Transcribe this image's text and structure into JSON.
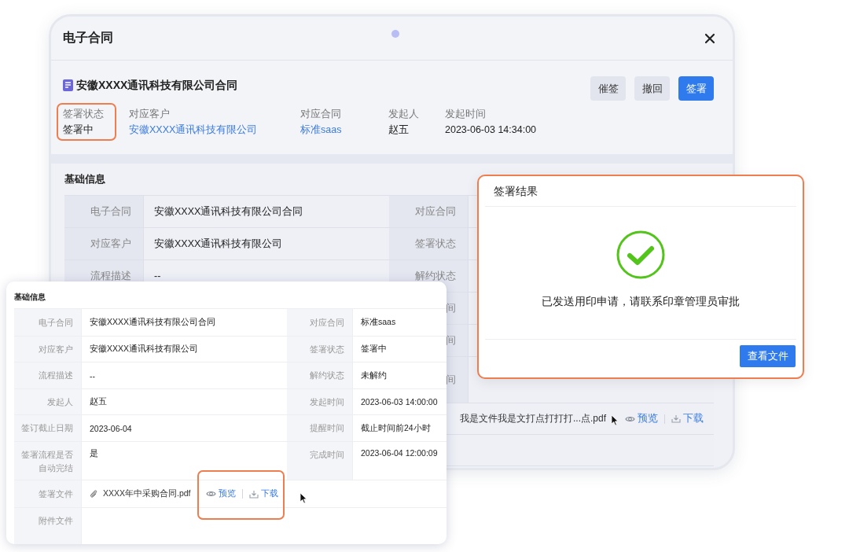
{
  "tablet_window": {
    "title": "电子合同",
    "contract": {
      "title": "安徽XXXX通讯科技有限公司合同",
      "buttons": [
        {
          "label": "催签",
          "kind": "secondary"
        },
        {
          "label": "撤回",
          "kind": "secondary"
        },
        {
          "label": "签署",
          "kind": "primary"
        }
      ],
      "fields": [
        {
          "label": "签署状态",
          "value": "签署中",
          "kind": "text",
          "highlighted": true
        },
        {
          "label": "对应客户",
          "value": "安徽XXXX通讯科技有限公司",
          "kind": "link"
        },
        {
          "label": "对应合同",
          "value": "标准saas",
          "kind": "link"
        },
        {
          "label": "发起人",
          "value": "赵五",
          "kind": "text"
        },
        {
          "label": "发起时间",
          "value": "2023-06-03 14:34:00",
          "kind": "text"
        }
      ]
    },
    "section_title": "基础信息",
    "rows": [
      {
        "left_label": "电子合同",
        "left_value": "安徽XXXX通讯科技有限公司合同",
        "right_label": "对应合同"
      },
      {
        "left_label": "对应客户",
        "left_value": "安徽XXXX通讯科技有限公司",
        "right_label": "签署状态"
      },
      {
        "left_label": "流程描述",
        "left_value": "--",
        "right_label": "解约状态"
      },
      {
        "right_label": "间"
      },
      {
        "right_label": "间"
      },
      {
        "right_label": "间"
      }
    ],
    "file_row": {
      "file_name": "我是文件我是文打点打打打...点.pdf",
      "preview": "预览",
      "download": "下载"
    }
  },
  "detail_panel": {
    "section_title": "基础信息",
    "rows": [
      {
        "left_label": "电子合同",
        "left_value": "安徽XXXX通讯科技有限公司合同",
        "right_label": "对应合同",
        "right_value": "标准saas"
      },
      {
        "left_label": "对应客户",
        "left_value": "安徽XXXX通讯科技有限公司",
        "right_label": "签署状态",
        "right_value": "签署中"
      },
      {
        "left_label": "流程描述",
        "left_value": "--",
        "right_label": "解约状态",
        "right_value": "未解约"
      },
      {
        "left_label": "发起人",
        "left_value": "赵五",
        "right_label": "发起时间",
        "right_value": "2023-06-03 14:00:00"
      },
      {
        "left_label": "签订截止日期",
        "left_value": "2023-06-04",
        "right_label": "提醒时间",
        "right_value": "截止时间前24小时"
      },
      {
        "left_label": "签署流程是否自动完结",
        "left_value": "是",
        "right_label": "完成时间",
        "right_value": "2023-06-04 12:00:09"
      }
    ],
    "file_row": {
      "label": "签署文件",
      "file_name": "XXXX年中采购合同.pdf",
      "preview": "预览",
      "download": "下载",
      "highlighted": true
    },
    "attachment_label": "附件文件"
  },
  "result_dialog": {
    "title": "签署结果",
    "message": "已发送用印申请，请联系印章管理员审批",
    "button": "查看文件"
  }
}
